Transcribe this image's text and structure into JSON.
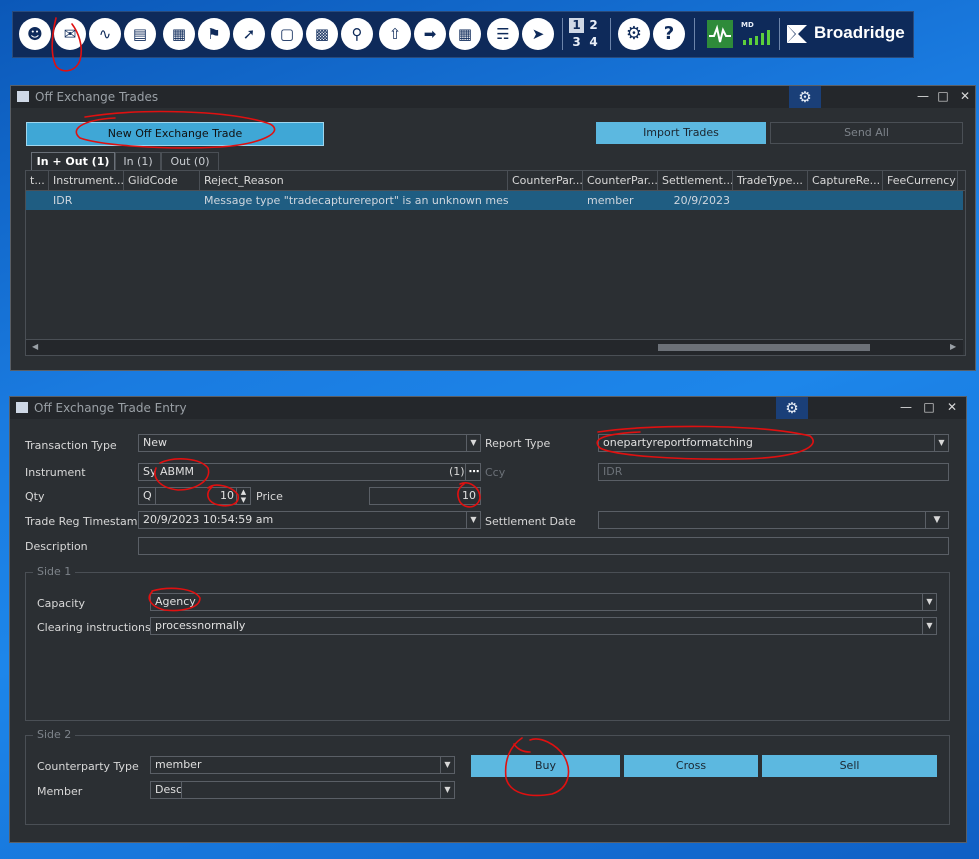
{
  "toolbar": {
    "icons": [
      "users-icon",
      "trade-entry-icon",
      "pulse-icon",
      "folder-icon",
      "calculator-icon",
      "bell-icon",
      "link-icon",
      "box-icon",
      "building-icon",
      "basket-icon",
      "upload-icon",
      "arrow-right-icon",
      "apps-icon",
      "megaphone-icon",
      "announce-icon",
      "settings-icon",
      "help-icon",
      "market-data-icon",
      "signal-icon"
    ],
    "grid_numbers": [
      "1",
      "2",
      "3",
      "4"
    ],
    "md_label": "MD",
    "brand": "Broadridge"
  },
  "trades_window": {
    "title": "Off Exchange Trades",
    "new_button": "New Off Exchange Trade",
    "import_button": "Import Trades",
    "send_all_button": "Send All",
    "tabs": [
      "In + Out (1)",
      "In (1)",
      "Out (0)"
    ],
    "columns": [
      "t...",
      "Instrument...",
      "GlidCode",
      "Reject_Reason",
      "CounterPar...",
      "CounterPar...",
      "Settlement...",
      "TradeType...",
      "CaptureRe...",
      "FeeCurrency"
    ],
    "rows": [
      {
        "instrument": "IDR",
        "glid": "",
        "reject": "Message type \"tradecapturereport\" is an unknown messa...",
        "cp1": "",
        "cp2": "member",
        "settlement": "20/9/2023"
      }
    ]
  },
  "entry_window": {
    "title": "Off Exchange Trade Entry",
    "transaction_type_label": "Transaction Type",
    "transaction_type": "New",
    "report_type_label": "Report Type",
    "report_type": "onepartyreportformatching",
    "instrument_label": "Instrument",
    "instrument_prefix": "Sy",
    "instrument_value": "ABMM",
    "instrument_count": "(1)",
    "ccy_label": "Ccy",
    "ccy_value": "IDR",
    "qty_label": "Qty",
    "qty_prefix": "Q",
    "qty_value": "10",
    "price_label": "Price",
    "price_value": "10",
    "trade_reg_label": "Trade Reg Timestamp",
    "trade_reg_value": "20/9/2023 10:54:59 am",
    "settlement_label": "Settlement Date",
    "settlement_value": "",
    "description_label": "Description",
    "description_value": "",
    "side1": {
      "title": "Side 1",
      "capacity_label": "Capacity",
      "capacity_value": "Agency",
      "clearing_label": "Clearing instructions",
      "clearing_value": "processnormally"
    },
    "side2": {
      "title": "Side 2",
      "cp_type_label": "Counterparty Type",
      "cp_type_value": "member",
      "member_label": "Member",
      "member_value": "Desc",
      "buy": "Buy",
      "cross": "Cross",
      "sell": "Sell"
    }
  },
  "colors": {
    "accent": "#5cb8e0",
    "panel": "#2b2f33",
    "annotation": "#e01010"
  }
}
